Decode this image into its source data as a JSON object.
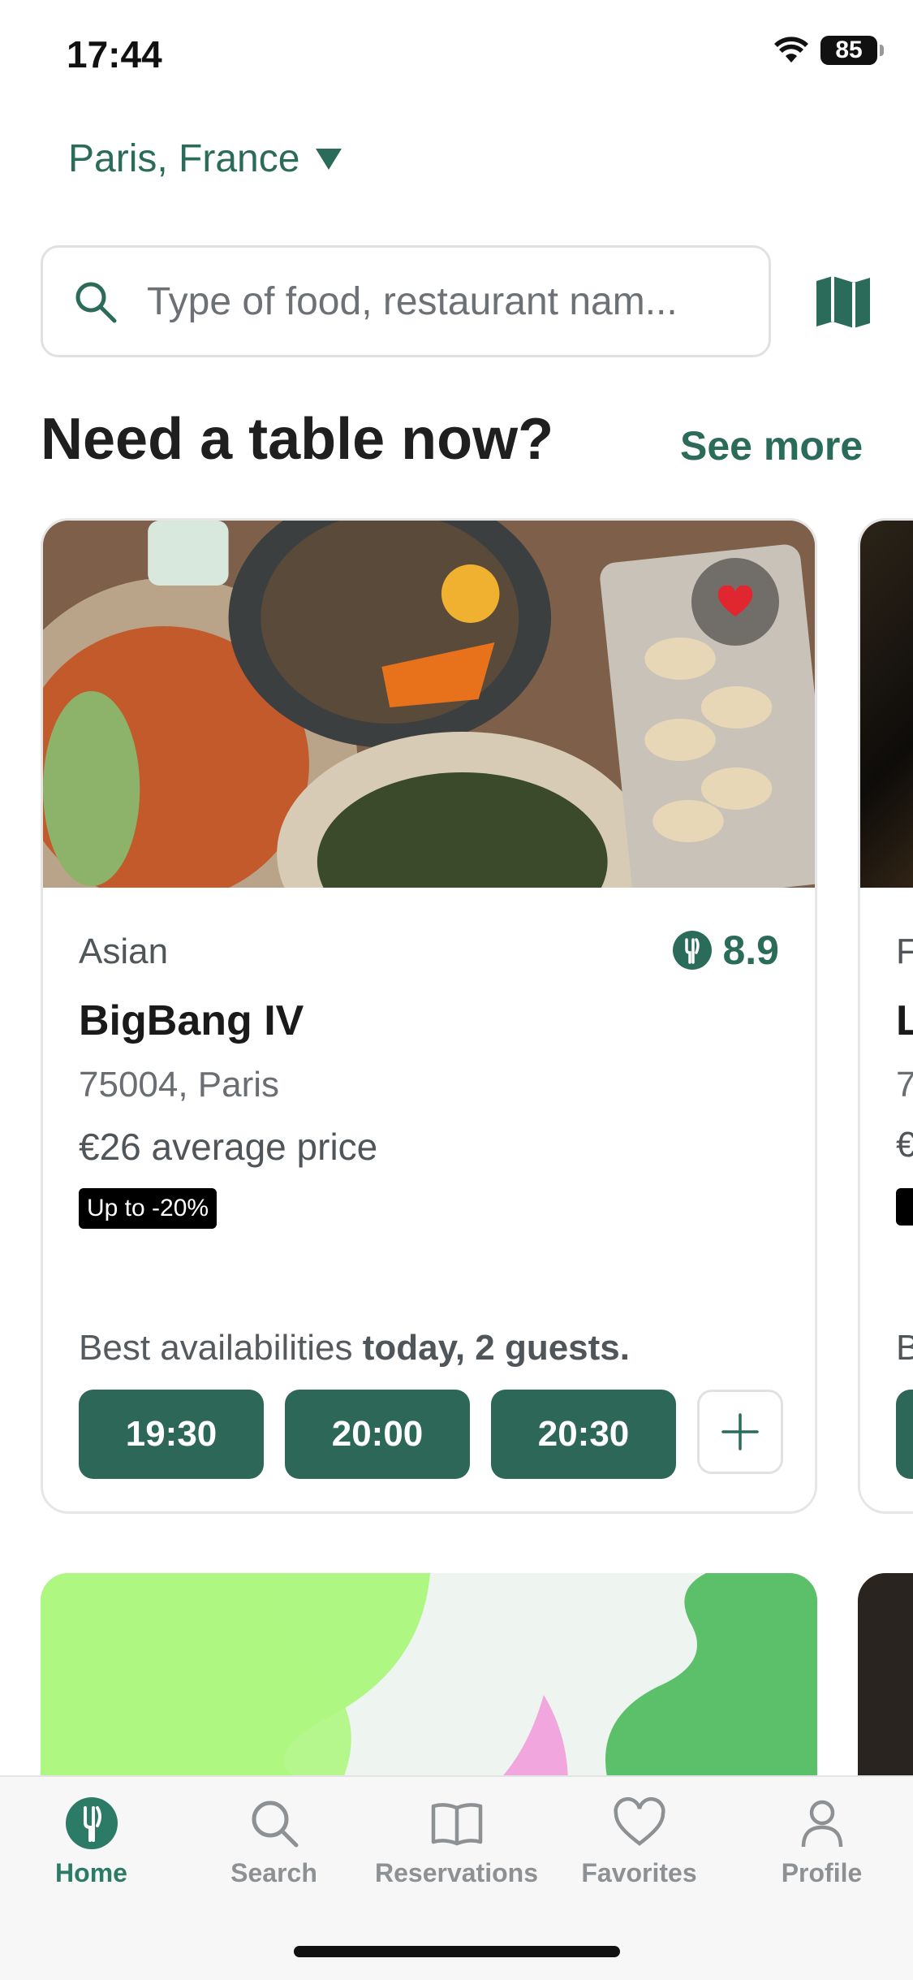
{
  "status": {
    "time": "17:44",
    "battery": "85"
  },
  "location": {
    "label": "Paris, France"
  },
  "search": {
    "placeholder": "Type of food, restaurant nam..."
  },
  "section": {
    "title": "Need a table now?",
    "see_more": "See more"
  },
  "card": {
    "cuisine": "Asian",
    "rating": "8.9",
    "name": "BigBang IV",
    "address": "75004, Paris",
    "price": "€26 average price",
    "promo": "Up to -20%",
    "availability_prefix": "Best availabilities ",
    "availability_bold": "today, 2 guests.",
    "slots": [
      "19:30",
      "20:00",
      "20:30"
    ]
  },
  "peek": {
    "cuisine_initial": "F",
    "name_initial": "L",
    "address_initial": "7",
    "price_initial": "€",
    "avail_initial": "B"
  },
  "tabs": [
    {
      "label": "Home",
      "icon": "fork-icon",
      "active": true
    },
    {
      "label": "Search",
      "icon": "search-icon"
    },
    {
      "label": "Reservations",
      "icon": "book-icon"
    },
    {
      "label": "Favorites",
      "icon": "heart-icon"
    },
    {
      "label": "Profile",
      "icon": "person-icon"
    }
  ],
  "colors": {
    "brand": "#2b6b5a",
    "slot": "#2c6758",
    "promo_bg": "#000000",
    "favorite": "#e0262f"
  }
}
